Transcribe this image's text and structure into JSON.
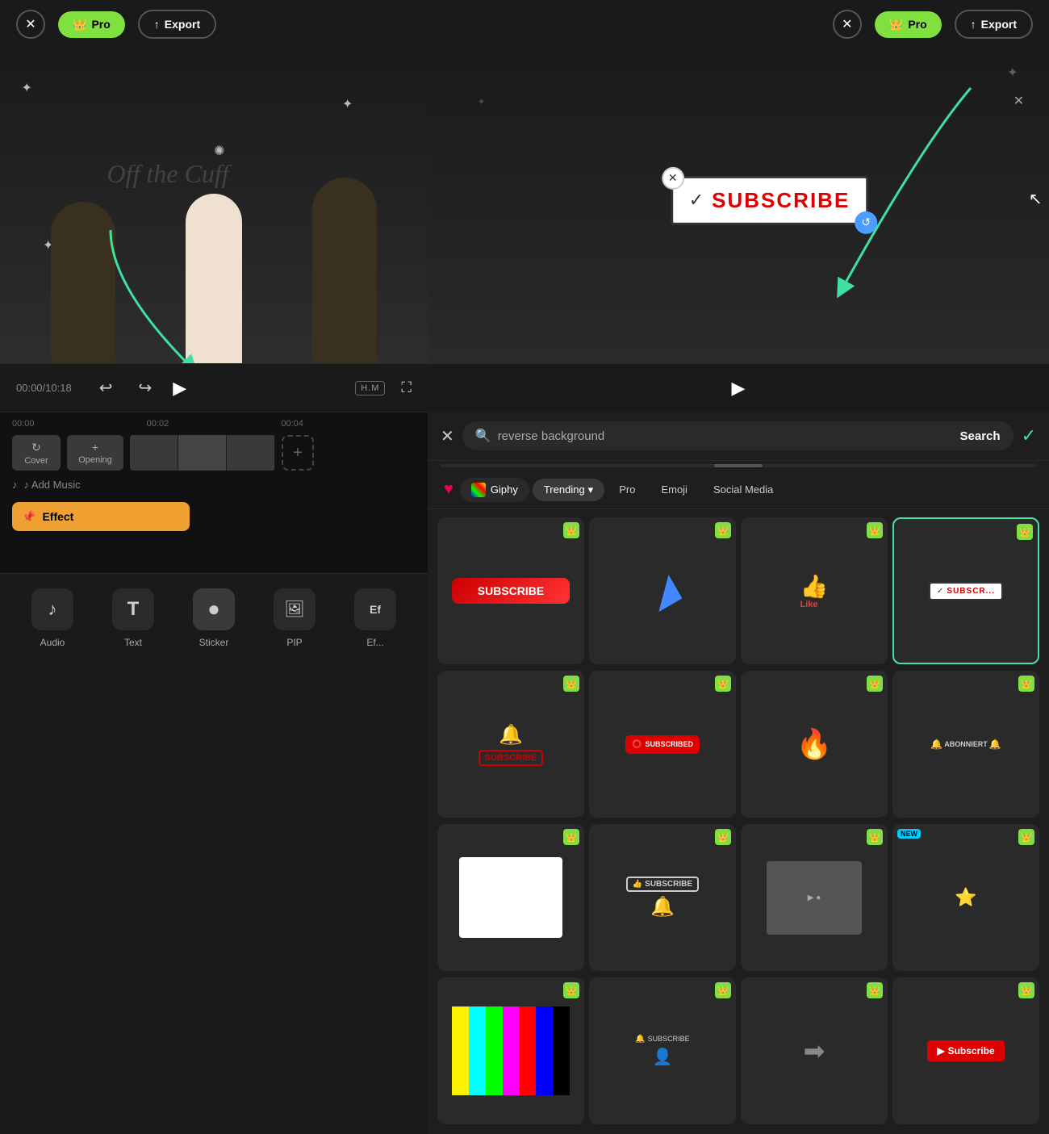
{
  "topBar": {
    "closeLabel": "✕",
    "proLabel": "Pro",
    "proIcon": "👑",
    "exportLabel": "Export",
    "exportIcon": "↑"
  },
  "leftPanel": {
    "controls": {
      "undoLabel": "↩",
      "redoLabel": "↪",
      "playLabel": "▶",
      "hdrLabel": "H.M",
      "expandLabel": "⛶",
      "timeDisplay": "00:00/10:18"
    },
    "timeline": {
      "times": [
        "00:00",
        "00:02",
        "00:04"
      ],
      "coverLabel": "Cover",
      "openingLabel": "Opening",
      "addMusicLabel": "♪ Add Music",
      "effectLabel": "Effect",
      "addClipLabel": "+"
    },
    "bottomTools": [
      {
        "id": "audio",
        "icon": "♪",
        "label": "Audio"
      },
      {
        "id": "text",
        "icon": "T",
        "label": "Text"
      },
      {
        "id": "sticker",
        "icon": "●",
        "label": "Sticker",
        "active": true
      },
      {
        "id": "pip",
        "icon": "🖼",
        "label": "PIP"
      },
      {
        "id": "effect",
        "icon": "Ef",
        "label": "Ef..."
      }
    ]
  },
  "rightPanel": {
    "searchBar": {
      "closeLabel": "✕",
      "searchPlaceholder": "reverse background",
      "searchLabel": "Search",
      "confirmLabel": "✓"
    },
    "categoryTabs": {
      "favorites": "♥",
      "giphy": "Giphy",
      "trending": "Trending",
      "pro": "Pro",
      "emoji": "Emoji",
      "socialMedia": "Social Media"
    },
    "stickers": [
      {
        "id": "s1",
        "type": "subscribe-red",
        "pro": true,
        "label": "SUBSCRIBE"
      },
      {
        "id": "s2",
        "type": "blue-cursor",
        "pro": true,
        "label": ""
      },
      {
        "id": "s3",
        "type": "like-thumbs",
        "pro": true,
        "label": "👍 Like"
      },
      {
        "id": "s4",
        "type": "subscribe-outline",
        "pro": true,
        "label": "✓ SUBSCR...",
        "selected": true
      },
      {
        "id": "s5",
        "type": "subscribe-bell",
        "pro": true,
        "label": ""
      },
      {
        "id": "s6",
        "type": "subscribed-badge",
        "pro": true,
        "label": "SUBSCRIBED"
      },
      {
        "id": "s7",
        "type": "fire-bar",
        "pro": true,
        "label": ""
      },
      {
        "id": "s8",
        "type": "abonniert",
        "pro": true,
        "label": "ABONNIERT"
      },
      {
        "id": "s9",
        "type": "white-box",
        "pro": true,
        "label": ""
      },
      {
        "id": "s10",
        "type": "subscribe-ring",
        "pro": true,
        "label": ""
      },
      {
        "id": "s11",
        "type": "dark-thing",
        "pro": true,
        "label": ""
      },
      {
        "id": "s12",
        "type": "color-bar",
        "pro": true,
        "label": ""
      },
      {
        "id": "s13",
        "type": "color-bars",
        "pro": true,
        "label": ""
      },
      {
        "id": "s14",
        "type": "badge-new",
        "pro": true,
        "new": true,
        "label": ""
      },
      {
        "id": "s15",
        "type": "arrow-right",
        "pro": true,
        "label": ""
      },
      {
        "id": "s16",
        "type": "subscribe-btn",
        "pro": true,
        "label": ""
      }
    ]
  }
}
